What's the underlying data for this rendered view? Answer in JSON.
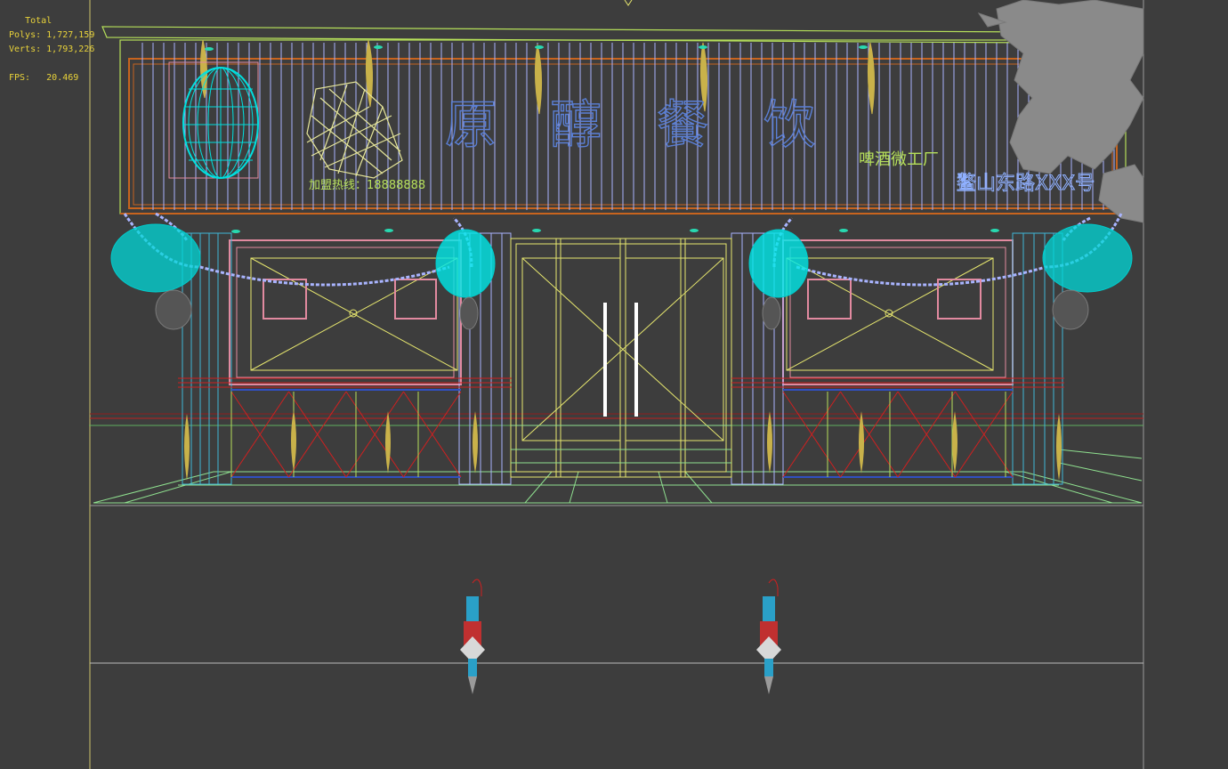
{
  "stats": {
    "total_label": "Total",
    "polys_label": "Polys:",
    "polys_value": "1,727,159",
    "verts_label": "Verts:",
    "verts_value": "1,793,226",
    "fps_label": "FPS:",
    "fps_value": "20.469"
  },
  "signboard": {
    "title_chars": [
      "原",
      "醇",
      "餐",
      "饮"
    ],
    "phone_text": "加盟热线：18888888",
    "subtitle": "啤酒微工厂",
    "address": "鳌山东路XXX号"
  },
  "colors": {
    "background": "#3d3d3d",
    "stats_text": "#e8d23a",
    "sign_text": "#5a7fd6",
    "lime": "#b6e05a",
    "cyan": "#00ffff",
    "orange": "#c8641e",
    "pink": "#e28aa0",
    "yellow": "#e6e66e",
    "red": "#d02020",
    "lavender": "#a9b4ff",
    "green": "#8fe08f",
    "tree": "#8a8a8a"
  },
  "icons": {
    "viewport_marker": "viewpoint-marker-icon",
    "tree": "tree-foliage-icon",
    "barrel": "barrel-icon",
    "lantern": "lantern-icon",
    "wall_lamp": "wall-lamp-icon"
  }
}
